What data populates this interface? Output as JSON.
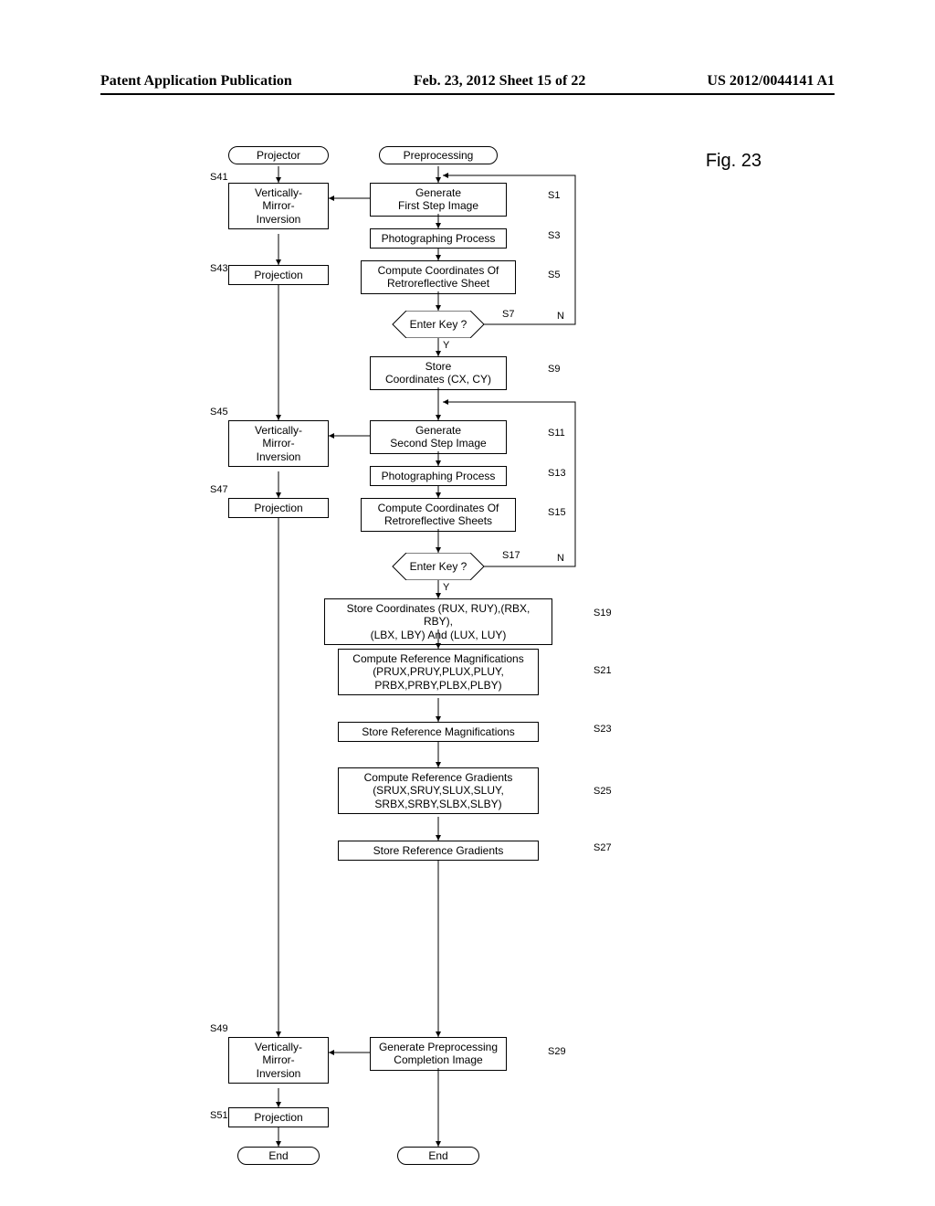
{
  "header": {
    "left": "Patent Application Publication",
    "center": "Feb. 23, 2012  Sheet 15 of 22",
    "right": "US 2012/0044141 A1"
  },
  "figure_label": "Fig. 23",
  "projector": {
    "title": "Projector",
    "s41": {
      "label": "S41",
      "text": "Vertically-\nMirror-\nInversion"
    },
    "s43": {
      "label": "S43",
      "text": "Projection"
    },
    "s45": {
      "label": "S45",
      "text": "Vertically-\nMirror-\nInversion"
    },
    "s47": {
      "label": "S47",
      "text": "Projection"
    },
    "s49": {
      "label": "S49",
      "text": "Vertically-\nMirror-\nInversion"
    },
    "s51": {
      "label": "S51",
      "text": "Projection"
    },
    "end": "End"
  },
  "preprocessing": {
    "title": "Preprocessing",
    "s1": {
      "label": "S1",
      "text": "Generate\nFirst Step Image"
    },
    "s3": {
      "label": "S3",
      "text": "Photographing Process"
    },
    "s5": {
      "label": "S5",
      "text": "Compute Coordinates Of\nRetroreflective Sheet"
    },
    "s7": {
      "label": "S7",
      "text": "Enter Key ?",
      "yes": "Y",
      "no": "N"
    },
    "s9": {
      "label": "S9",
      "text": "Store\nCoordinates (CX, CY)"
    },
    "s11": {
      "label": "S11",
      "text": "Generate\nSecond Step Image"
    },
    "s13": {
      "label": "S13",
      "text": "Photographing Process"
    },
    "s15": {
      "label": "S15",
      "text": "Compute Coordinates Of\nRetroreflective Sheets"
    },
    "s17": {
      "label": "S17",
      "text": "Enter Key ?",
      "yes": "Y",
      "no": "N"
    },
    "s19": {
      "label": "S19",
      "text": "Store Coordinates (RUX, RUY),(RBX, RBY),\n(LBX, LBY) And (LUX, LUY)"
    },
    "s21": {
      "label": "S21",
      "text": "Compute Reference Magnifications\n(PRUX,PRUY,PLUX,PLUY,\nPRBX,PRBY,PLBX,PLBY)"
    },
    "s23": {
      "label": "S23",
      "text": "Store Reference Magnifications"
    },
    "s25": {
      "label": "S25",
      "text": "Compute Reference Gradients\n(SRUX,SRUY,SLUX,SLUY,\nSRBX,SRBY,SLBX,SLBY)"
    },
    "s27": {
      "label": "S27",
      "text": "Store Reference Gradients"
    },
    "s29": {
      "label": "S29",
      "text": "Generate Preprocessing\nCompletion Image"
    },
    "end": "End"
  }
}
